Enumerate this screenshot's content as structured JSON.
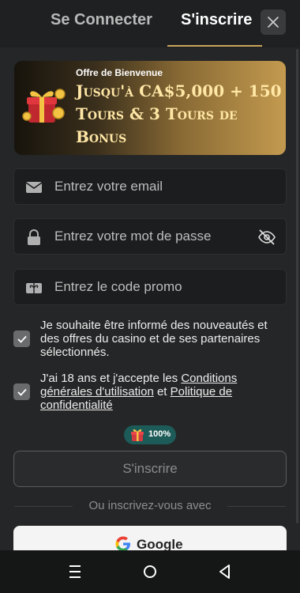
{
  "tabs": {
    "login": "Se Connecter",
    "register": "S'inscrire"
  },
  "banner": {
    "eyebrow": "Offre de Bienvenue",
    "headline": "Jusqu'à CA$5,000 + 150 Tours & 3 Tours de Bonus"
  },
  "form": {
    "email_placeholder": "Entrez votre email",
    "password_placeholder": "Entrez votre mot de passe",
    "promo_placeholder": "Entrez le code promo",
    "newsletter_text": "Je souhaite être informé des nouveautés et des offres du casino et de ses partenaires sélectionnés.",
    "terms_prefix": "J'ai 18 ans et j'accepte les ",
    "terms_link": "Conditions générales d'utilisation",
    "terms_and": " et ",
    "privacy_link": "Politique de confidentialité",
    "progress_badge": "100%",
    "submit_label": "S'inscrire",
    "alt_divider": "Ou inscrivez-vous avec",
    "google_label": "Google"
  },
  "colors": {
    "accent": "#c9a35a",
    "badge": "#1d5b59",
    "background": "#1f2021"
  },
  "icons": {
    "close": "close-icon",
    "email": "envelope-icon",
    "password": "lock-icon",
    "visibility": "eye-off-icon",
    "promo": "ticket-icon",
    "gift": "gift-icon"
  }
}
